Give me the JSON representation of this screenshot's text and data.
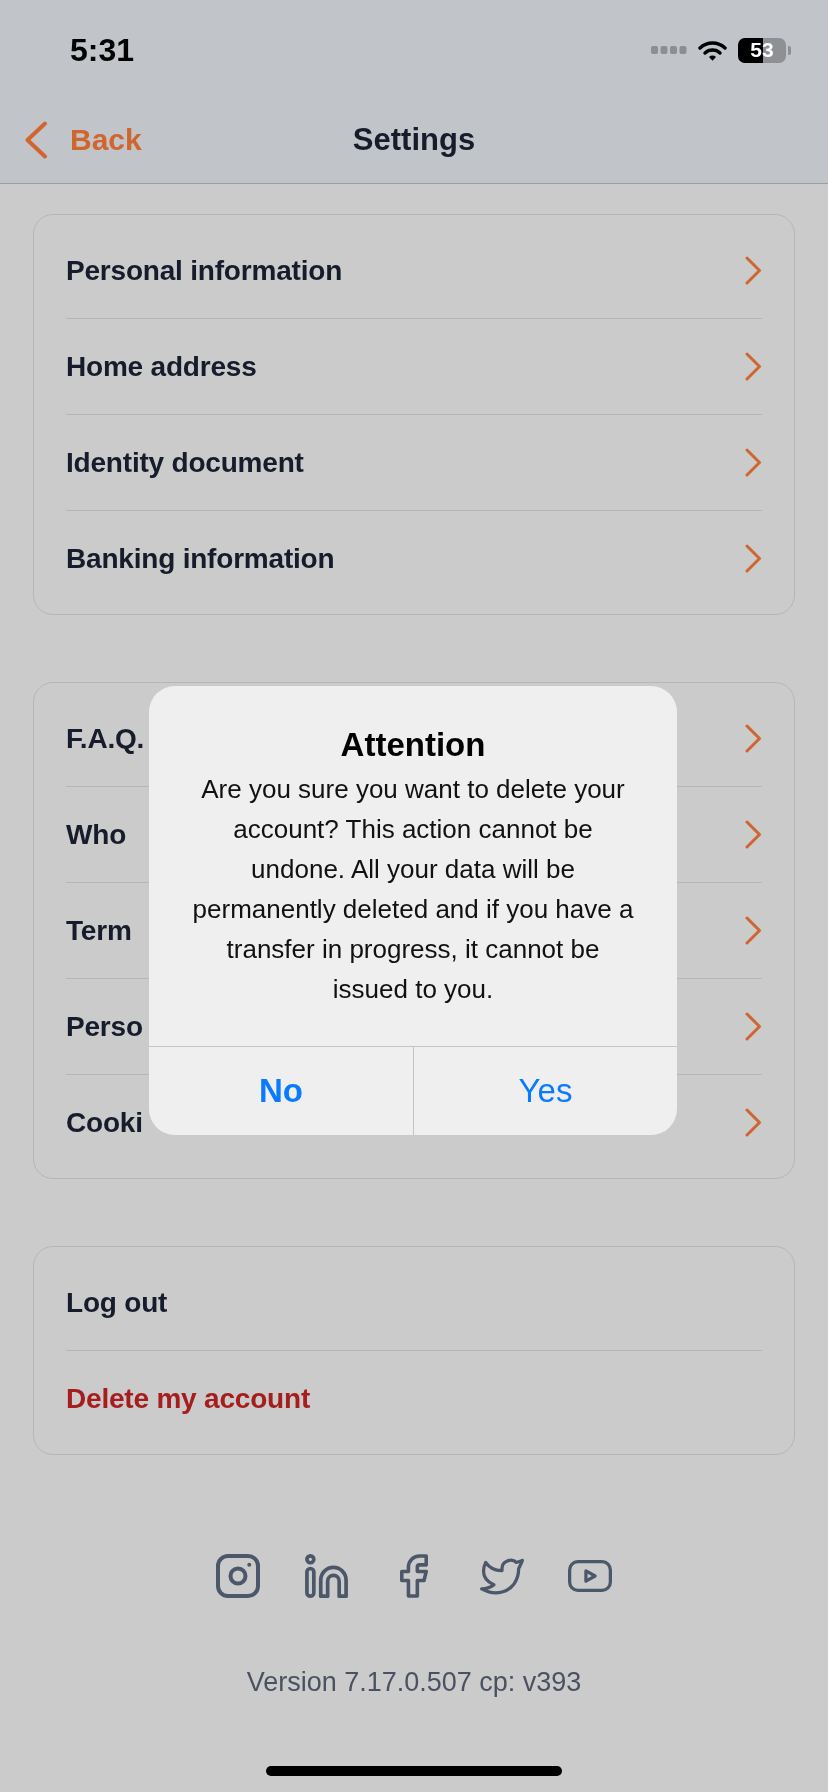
{
  "status_bar": {
    "time": "5:31",
    "battery": "53"
  },
  "nav_bar": {
    "back": "Back",
    "title": "Settings"
  },
  "sections": [
    {
      "items": [
        {
          "label": "Personal information",
          "kind": "link"
        },
        {
          "label": "Home address",
          "kind": "link"
        },
        {
          "label": "Identity document",
          "kind": "link"
        },
        {
          "label": "Banking information",
          "kind": "link"
        }
      ]
    },
    {
      "items": [
        {
          "label": "F.A.Q.",
          "kind": "link"
        },
        {
          "label": "Who",
          "kind": "link"
        },
        {
          "label": "Term",
          "kind": "link"
        },
        {
          "label": "Perso",
          "kind": "link"
        },
        {
          "label": "Cooki",
          "kind": "link"
        }
      ]
    },
    {
      "items": [
        {
          "label": "Log out",
          "kind": "action"
        },
        {
          "label": "Delete my account",
          "kind": "destructive"
        }
      ]
    }
  ],
  "footer": {
    "version": "Version 7.17.0.507 cp: v393"
  },
  "alert": {
    "title": "Attention",
    "message": "Are you sure you want to delete your account? This action cannot be undone. All your data will be permanently deleted and if you have a transfer in progress, it cannot be issued to you.",
    "buttons": [
      {
        "label": "No",
        "kind": "cancel"
      },
      {
        "label": "Yes",
        "kind": "default"
      }
    ]
  }
}
